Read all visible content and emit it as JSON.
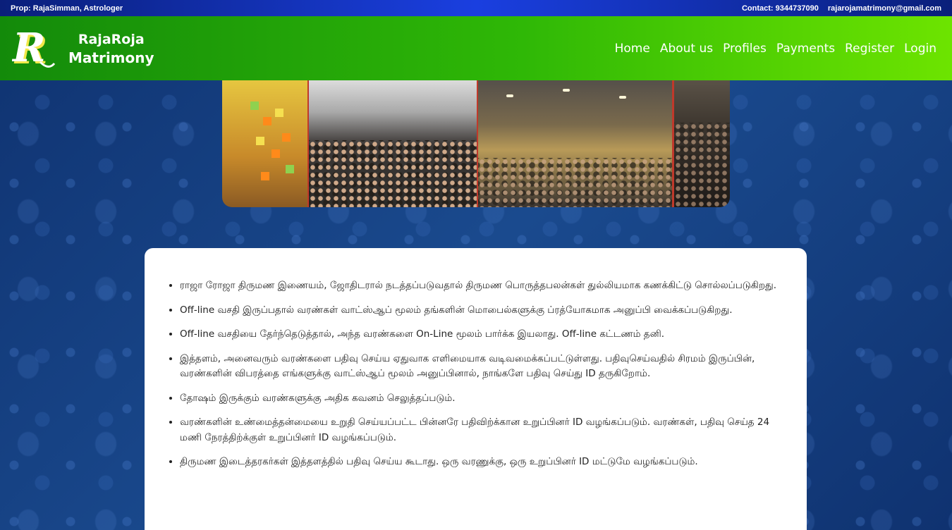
{
  "topbar": {
    "left_text": "Prop: RajaSimman, Astrologer",
    "contact": "Contact: 9344737090",
    "email": "rajarojamatrimony@gmail.com"
  },
  "brand": {
    "logo_letter": "R",
    "name_line1": "RajaRoja",
    "name_line2": "Matrimony"
  },
  "nav": {
    "items": [
      "Home",
      "About us",
      "Profiles",
      "Payments",
      "Register",
      "Login"
    ]
  },
  "content": {
    "points": [
      "ராஜா ரோஜா திருமண இணையம், ஜோதிடரால் நடத்தப்படுவதால் திருமண பொருத்தபலன்கள் துல்லியமாக கணக்கிட்டு சொல்லப்படுகிறது.",
      "Off-line வசதி இருப்பதால் வரண்கள் வாட்ஸ்ஆப் மூலம் தங்களின் மொபைல்களுக்கு ப்ரத்யோகமாக அனுப்பி வைக்கப்படுகிறது.",
      "Off-line வசதியை தேர்ந்தெடுத்தால், அந்த வரண்களை On-Line மூலம் பார்க்க இயலாது. Off-line கட்டணம் தனி.",
      "இத்தளம், அனைவரும் வரண்களை பதிவு செய்ய ஏதுவாக எளிமையாக வடிவமைக்கப்பட்டுள்ளது. பதிவுசெய்வதில் சிரமம் இருப்பின், வரண்களின் விபரத்தை எங்களுக்கு வாட்ஸ்ஆப் மூலம் அனுப்பினால், நாங்களே பதிவு செய்து ID தருகிறோம்.",
      "தோஷம் இருக்கும் வரண்களுக்கு அதிக கவனம் செலுத்தப்படும்.",
      "வரண்களின் உண்மைத்தன்மையை உறுதி செய்யப்பட்ட பின்னரே பதிவிற்க்கான உறுப்பினர் ID வழங்கப்படும். வரண்கள், பதிவு செய்த 24 மணி நேரத்திற்க்குள் உறுப்பினர் ID வழங்கப்படும்.",
      "திருமண இடைத்தரகர்கள் இத்தளத்தில் பதிவு செய்ய கூடாது. ஒரு வரணுக்கு, ஒரு உறுப்பினர் ID மட்டுமே வழங்கப்படும்."
    ]
  },
  "colors": {
    "topbar": "#1a3fe0",
    "navbar_start": "#138a0a",
    "navbar_end": "#6de400",
    "background": "#123a78"
  }
}
